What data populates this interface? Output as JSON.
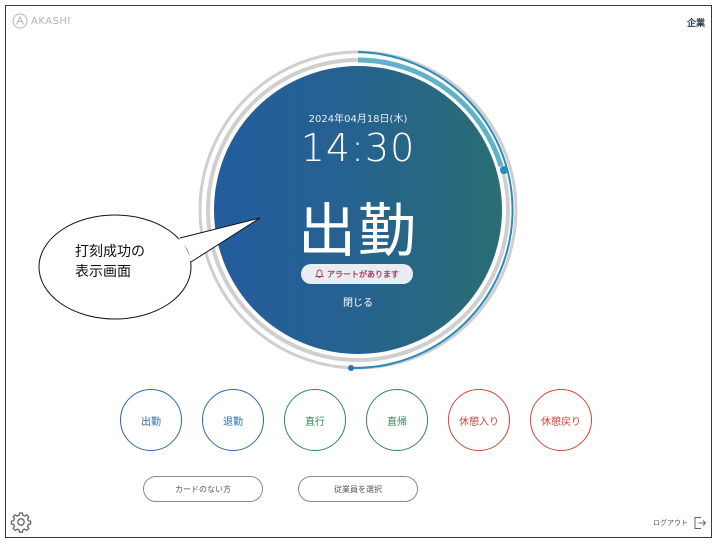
{
  "header": {
    "logo_text": "AKASHI",
    "company_label": "企業"
  },
  "clock": {
    "date": "2024年04月18日(木)",
    "time": "14:30",
    "status": "出勤",
    "progress_fraction": 0.37
  },
  "alert": {
    "label": "アラートがあります"
  },
  "close_label": "閉じる",
  "punch_buttons": [
    {
      "label": "出勤",
      "color": "#2c6aa5"
    },
    {
      "label": "退勤",
      "color": "#2c6aa5"
    },
    {
      "label": "直行",
      "color": "#2f8a4f"
    },
    {
      "label": "直帰",
      "color": "#2f8a4f"
    },
    {
      "label": "休憩入り",
      "color": "#d0453b"
    },
    {
      "label": "休憩戻り",
      "color": "#d0453b"
    }
  ],
  "actions": {
    "no_card": "カードのない方",
    "select_employee": "従業員を選択"
  },
  "footer": {
    "logout": "ログアウト"
  },
  "callout": {
    "line1": "打刻成功の",
    "line2": "表示画面"
  },
  "icons": {
    "settings": "gear-icon",
    "logout": "logout-icon",
    "alert": "bell-icon",
    "logo": "akashi-logo-icon"
  }
}
